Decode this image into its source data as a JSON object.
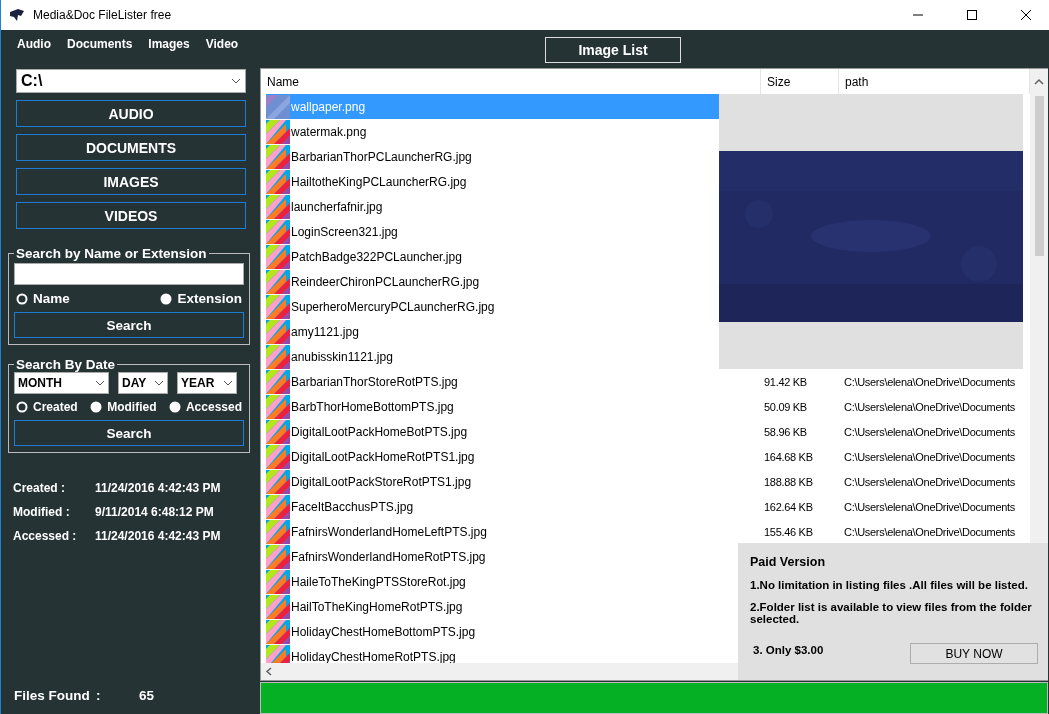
{
  "window": {
    "title": "Media&Doc FileLister free"
  },
  "menu": [
    "Audio",
    "Documents",
    "Images",
    "Video"
  ],
  "image_list_button": "Image List",
  "drive": {
    "value": "C:\\"
  },
  "category_buttons": [
    "AUDIO",
    "DOCUMENTS",
    "IMAGES",
    "VIDEOS"
  ],
  "name_search": {
    "title": "Search by Name or Extension",
    "options": [
      {
        "label": "Name",
        "selected": true
      },
      {
        "label": "Extension",
        "selected": false
      }
    ],
    "button": "Search"
  },
  "date_search": {
    "title": "Search By Date",
    "dropdowns": [
      "MONTH",
      "DAY",
      "YEAR"
    ],
    "options": [
      {
        "label": "Created",
        "selected": true
      },
      {
        "label": "Modified",
        "selected": false
      },
      {
        "label": "Accessed",
        "selected": false
      }
    ],
    "button": "Search"
  },
  "file_info": [
    {
      "label": "Created :",
      "value": "11/24/2016 4:42:43 PM"
    },
    {
      "label": "Modified :",
      "value": "9/11/2014 6:48:12 PM"
    },
    {
      "label": "Accessed :",
      "value": "11/24/2016 4:42:43 PM"
    }
  ],
  "files_found": {
    "label": "Files Found",
    "separator": ":",
    "value": "65"
  },
  "file_list": {
    "columns": [
      "Name",
      "Size",
      "path"
    ],
    "rows": [
      {
        "name": "wallpaper.png",
        "selected": true
      },
      {
        "name": "watermak.png",
        "selected": false
      },
      {
        "name": "BarbarianThorPCLauncherRG.jpg",
        "selected": false
      },
      {
        "name": "HailtotheKingPCLauncherRG.jpg",
        "selected": false
      },
      {
        "name": "launcherfafnir.jpg",
        "selected": false
      },
      {
        "name": "LoginScreen321.jpg",
        "selected": false
      },
      {
        "name": "PatchBadge322PCLauncher.jpg",
        "selected": false
      },
      {
        "name": "ReindeerChironPCLauncherRG.jpg",
        "selected": false
      },
      {
        "name": "SuperheroMercuryPCLauncherRG.jpg",
        "selected": false
      },
      {
        "name": "amy1121.jpg",
        "selected": false
      },
      {
        "name": "anubisskin1121.jpg",
        "selected": false
      },
      {
        "name": "BarbarianThorStoreRotPTS.jpg",
        "selected": false,
        "size": "91.42 KB",
        "path": "C:\\Users\\elena\\OneDrive\\Documents"
      },
      {
        "name": "BarbThorHomeBottomPTS.jpg",
        "selected": false,
        "size": "50.09 KB",
        "path": "C:\\Users\\elena\\OneDrive\\Documents"
      },
      {
        "name": "DigitalLootPackHomeBotPTS.jpg",
        "selected": false,
        "size": "58.96 KB",
        "path": "C:\\Users\\elena\\OneDrive\\Documents"
      },
      {
        "name": "DigitalLootPackHomeRotPTS1.jpg",
        "selected": false,
        "size": "164.68 KB",
        "path": "C:\\Users\\elena\\OneDrive\\Documents"
      },
      {
        "name": "DigitalLootPackStoreRotPTS1.jpg",
        "selected": false,
        "size": "188.88 KB",
        "path": "C:\\Users\\elena\\OneDrive\\Documents"
      },
      {
        "name": "FaceItBacchusPTS.jpg",
        "selected": false,
        "size": "162.64 KB",
        "path": "C:\\Users\\elena\\OneDrive\\Documents"
      },
      {
        "name": "FafnirsWonderlandHomeLeftPTS.jpg",
        "selected": false,
        "size": "155.46 KB",
        "path": "C:\\Users\\elena\\OneDrive\\Documents"
      },
      {
        "name": "FafnirsWonderlandHomeRotPTS.jpg",
        "selected": false
      },
      {
        "name": "HaileToTheKingPTSStoreRot.jpg",
        "selected": false
      },
      {
        "name": "HailToTheKingHomeRotPTS.jpg",
        "selected": false
      },
      {
        "name": "HolidayChestHomeBottomPTS.jpg",
        "selected": false
      },
      {
        "name": "HolidayChestHomeRotPTS.jpg",
        "selected": false
      }
    ]
  },
  "paid_panel": {
    "title": "Paid Version",
    "points": [
      "1.No limitation in listing files .All files will be listed.",
      "2.Folder list is available to view files from the folder selected."
    ],
    "price": "3. Only $3.00",
    "button": "BUY NOW"
  },
  "progress": {
    "level": 1
  }
}
